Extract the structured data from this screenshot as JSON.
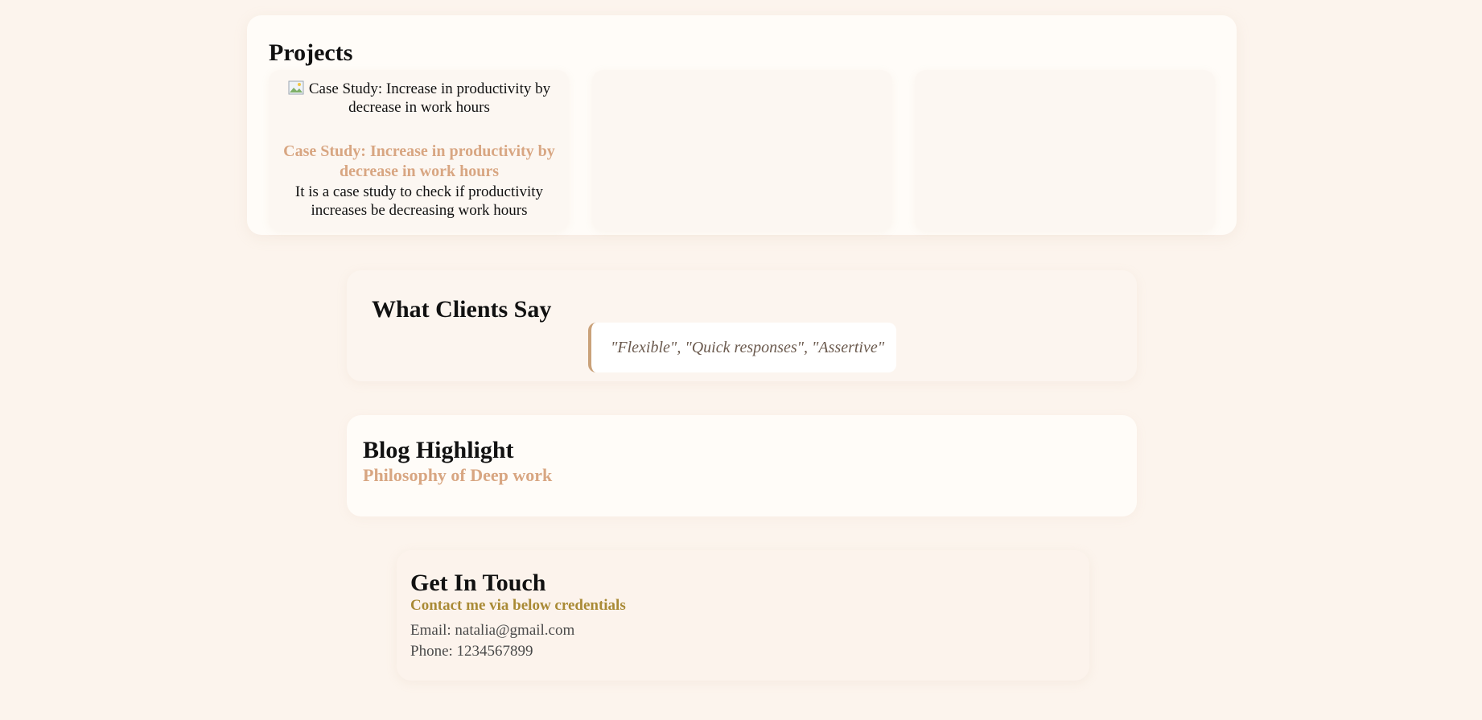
{
  "projects": {
    "heading": "Projects",
    "items": [
      {
        "image_alt": "Case Study: Increase in productivity by decrease in work hours",
        "title": "Case Study: Increase in productivity by decrease in work hours",
        "description": "It is a case study to check if productivity increases be decreasing work hours"
      }
    ]
  },
  "clients": {
    "heading": "What Clients Say",
    "quote": "\"Flexible\", \"Quick responses\", \"Assertive\""
  },
  "blog": {
    "heading": "Blog Highlight",
    "post_title": "Philosophy of Deep work"
  },
  "contact": {
    "heading": "Get In Touch",
    "subtitle": "Contact me via below credentials",
    "email_line": "Email: natalia@gmail.com",
    "phone_line": "Phone: 1234567899"
  },
  "colors": {
    "page_bg": "#fcf4ed",
    "accent": "#d8a682",
    "contact_accent": "#a98a35",
    "quote_border": "#caa27a"
  },
  "icons": {
    "broken_image": "broken-image-icon"
  }
}
